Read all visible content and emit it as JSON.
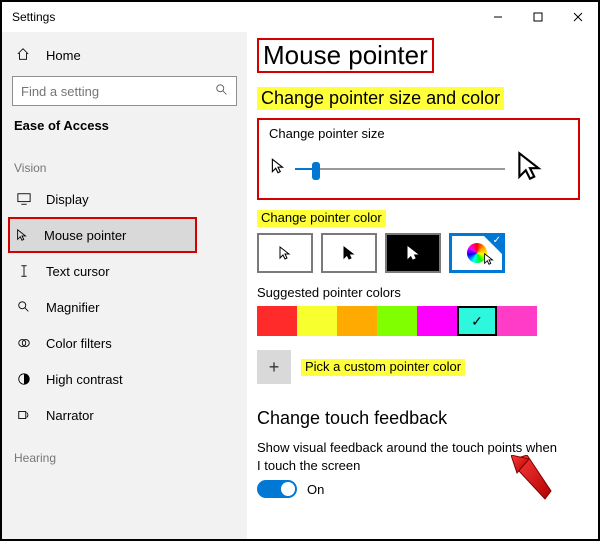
{
  "window": {
    "title": "Settings"
  },
  "sidebar": {
    "home": "Home",
    "search_placeholder": "Find a setting",
    "category": "Ease of Access",
    "groups": {
      "vision": "Vision",
      "hearing": "Hearing"
    },
    "items": {
      "display": "Display",
      "mouse_pointer": "Mouse pointer",
      "text_cursor": "Text cursor",
      "magnifier": "Magnifier",
      "color_filters": "Color filters",
      "high_contrast": "High contrast",
      "narrator": "Narrator"
    }
  },
  "page": {
    "title": "Mouse pointer",
    "section_size_color": "Change pointer size and color",
    "pointer_size_label": "Change pointer size",
    "pointer_color_label": "Change pointer color",
    "suggested_label": "Suggested pointer colors",
    "custom_label": "Pick a custom pointer color",
    "touch_header": "Change touch feedback",
    "touch_desc": "Show visual feedback around the touch points when I touch the screen",
    "toggle_on": "On"
  },
  "swatches": [
    {
      "name": "red",
      "color": "#ff2a2a"
    },
    {
      "name": "yellow",
      "color": "#f7ff2e"
    },
    {
      "name": "orange",
      "color": "#ffaa00"
    },
    {
      "name": "lime",
      "color": "#80ff00"
    },
    {
      "name": "magenta",
      "color": "#ff00ff"
    },
    {
      "name": "cyan",
      "color": "#2df7dd",
      "selected": true
    },
    {
      "name": "pink",
      "color": "#ff3cc7"
    }
  ]
}
